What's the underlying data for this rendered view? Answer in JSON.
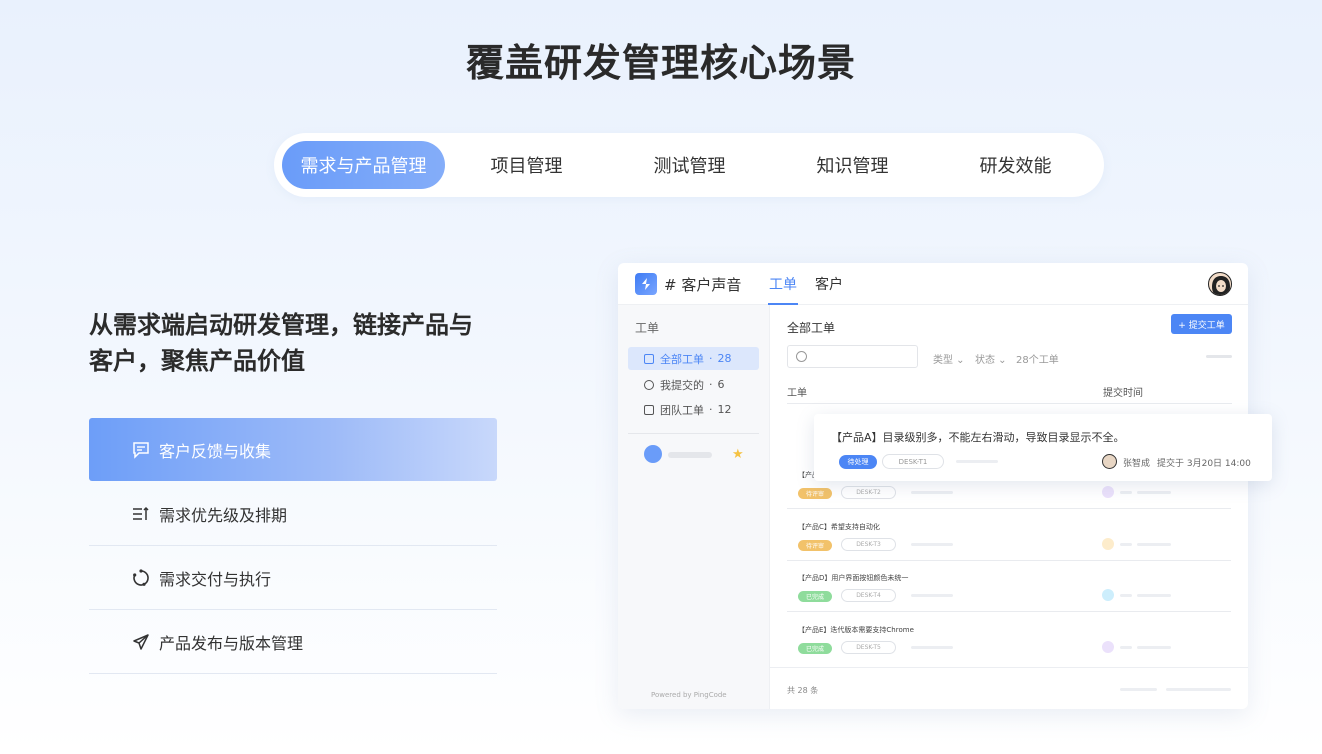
{
  "headline": "覆盖研发管理核心场景",
  "tabs": [
    "需求与产品管理",
    "项目管理",
    "测试管理",
    "知识管理",
    "研发效能"
  ],
  "active_tab": 0,
  "left": {
    "title_line1": "从需求端启动研发管理，链接产品与",
    "title_line2": "客户，聚焦产品价值",
    "features": [
      {
        "label": "客户反馈与收集",
        "icon": "chat-icon"
      },
      {
        "label": "需求优先级及排期",
        "icon": "sort-list-icon"
      },
      {
        "label": "需求交付与执行",
        "icon": "cycle-icon"
      },
      {
        "label": "产品发布与版本管理",
        "icon": "send-icon"
      }
    ]
  },
  "app": {
    "name": "# 客户声音",
    "header_tabs": [
      "工单",
      "客户"
    ],
    "sidebar": {
      "title": "工单",
      "items": [
        {
          "label": "全部工单",
          "count": "28"
        },
        {
          "label": "我提交的",
          "count": "6"
        },
        {
          "label": "团队工单",
          "count": "12"
        }
      ],
      "powered": "Powered by  PingCode"
    },
    "main": {
      "title": "全部工单",
      "submit": "+ 提交工单",
      "filters": [
        "类型 ⌄",
        "状态 ⌄",
        "28个工单"
      ],
      "col_ticket": "工单",
      "col_time": "提交时间",
      "rows": [
        {
          "title": "【产品",
          "status": "待评审",
          "code": "DESK-T2",
          "status_color": "#f2c26a",
          "dot_color": "#ebe1fb"
        },
        {
          "title": "【产品C】希望支持自动化",
          "status": "待评审",
          "code": "DESK-T3",
          "status_color": "#f2c26a",
          "dot_color": "#fdeccb"
        },
        {
          "title": "【产品D】用户界面按钮颜色未统一",
          "status": "已完成",
          "code": "DESK-T4",
          "status_color": "#8fdc9c",
          "dot_color": "#cdeefc"
        },
        {
          "title": "【产品E】迭代版本需要支持Chrome",
          "status": "已完成",
          "code": "DESK-T5",
          "status_color": "#8fdc9c",
          "dot_color": "#ebe1fb"
        }
      ],
      "footer": "共 28 条"
    },
    "popup": {
      "title": "【产品A】目录级别多，不能左右滑动，导致目录显示不全。",
      "status": "待处理",
      "code": "DESK-T1",
      "user": "张智成",
      "time": "提交于 3月20日 14:00"
    }
  }
}
